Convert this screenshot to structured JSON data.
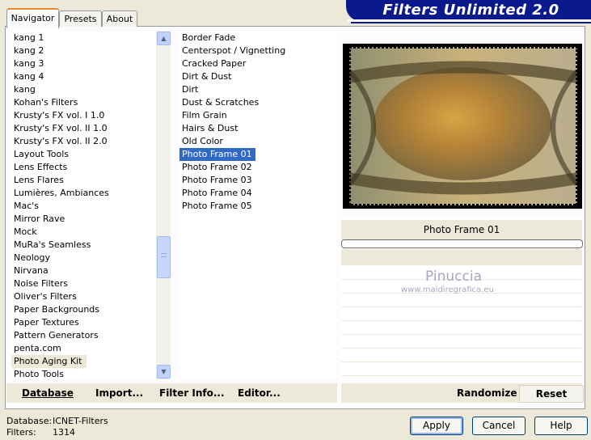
{
  "app": {
    "title": "Filters Unlimited 2.0"
  },
  "tabs": [
    {
      "label": "Navigator"
    },
    {
      "label": "Presets"
    },
    {
      "label": "About"
    }
  ],
  "categories": {
    "items": [
      "kang 1",
      "kang 2",
      "kang 3",
      "kang 4",
      "kang",
      "Kohan's Filters",
      "Krusty's FX vol. I 1.0",
      "Krusty's FX vol. II 1.0",
      "Krusty's FX vol. II 2.0",
      "Layout Tools",
      "Lens Effects",
      "Lens Flares",
      "Lumières, Ambiances",
      "Mac's",
      "Mirror Rave",
      "Mock",
      "MuRa's Seamless",
      "Neology",
      "Nirvana",
      "Noise Filters",
      "Oliver's Filters",
      "Paper Backgrounds",
      "Paper Textures",
      "Pattern Generators",
      "penta.com",
      "Photo Aging Kit",
      "Photo Tools"
    ],
    "highlighted": "Photo Aging Kit"
  },
  "filters": {
    "items": [
      "Border Fade",
      "Centerspot / Vignetting",
      "Cracked Paper",
      "Dirt & Dust",
      "Dirt",
      "Dust & Scratches",
      "Film Grain",
      "Hairs & Dust",
      "Old Color",
      "Photo Frame 01",
      "Photo Frame 02",
      "Photo Frame 03",
      "Photo Frame 04",
      "Photo Frame 05"
    ],
    "selected": "Photo Frame 01"
  },
  "preview": {
    "filter_name": "Photo Frame 01",
    "progress": 0,
    "watermark_name": "Pinuccia",
    "watermark_url": "www.maidiregrafica.eu"
  },
  "commands": {
    "database": "Database",
    "import": "Import...",
    "filter_info": "Filter Info...",
    "editor": "Editor...",
    "randomize": "Randomize",
    "reset": "Reset"
  },
  "status": {
    "database_label": "Database:",
    "database_value": "ICNET-Filters",
    "filters_label": "Filters:",
    "filters_value": "1314"
  },
  "buttons": {
    "apply": "Apply",
    "cancel": "Cancel",
    "help": "Help"
  },
  "colors": {
    "banner": "#0a1a8c",
    "selection": "#316ac5",
    "tab_accent": "#e68b2c"
  }
}
